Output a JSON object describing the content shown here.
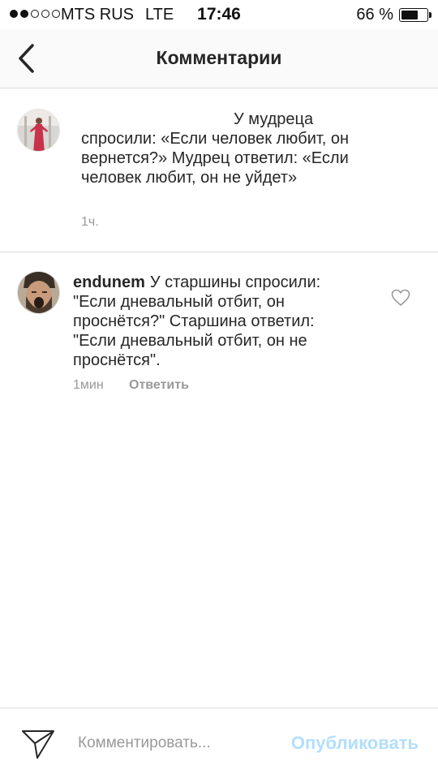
{
  "status_bar": {
    "carrier": "MTS RUS",
    "network": "LTE",
    "time": "17:46",
    "battery_percent": "66 %",
    "battery_level": 0.66,
    "signal_bars_filled": 2,
    "signal_bars_total": 5
  },
  "header": {
    "title": "Комментарии",
    "back_icon": "chevron-left-icon"
  },
  "caption": {
    "text": "У мудреца спросили: «Если человек любит, он вернется?» Мудрец ответил: «Если человек любит, он не уйдет»",
    "time": "1ч."
  },
  "comments": [
    {
      "username": "endunem",
      "text": "У старшины спросили: \"Если дневальный отбит, он проснётся?\" Старшина ответил: \"Если дневальный отбит, он не проснётся\".",
      "time": "1мин",
      "reply_label": "Ответить",
      "like_icon": "heart-outline-icon"
    }
  ],
  "composer": {
    "placeholder": "Комментировать...",
    "publish_label": "Опубликовать",
    "send_icon": "paper-plane-icon"
  },
  "colors": {
    "text": "#262626",
    "secondary_text": "#999999",
    "divider": "#dbdbdb",
    "publish_disabled": "#b2dffc"
  }
}
